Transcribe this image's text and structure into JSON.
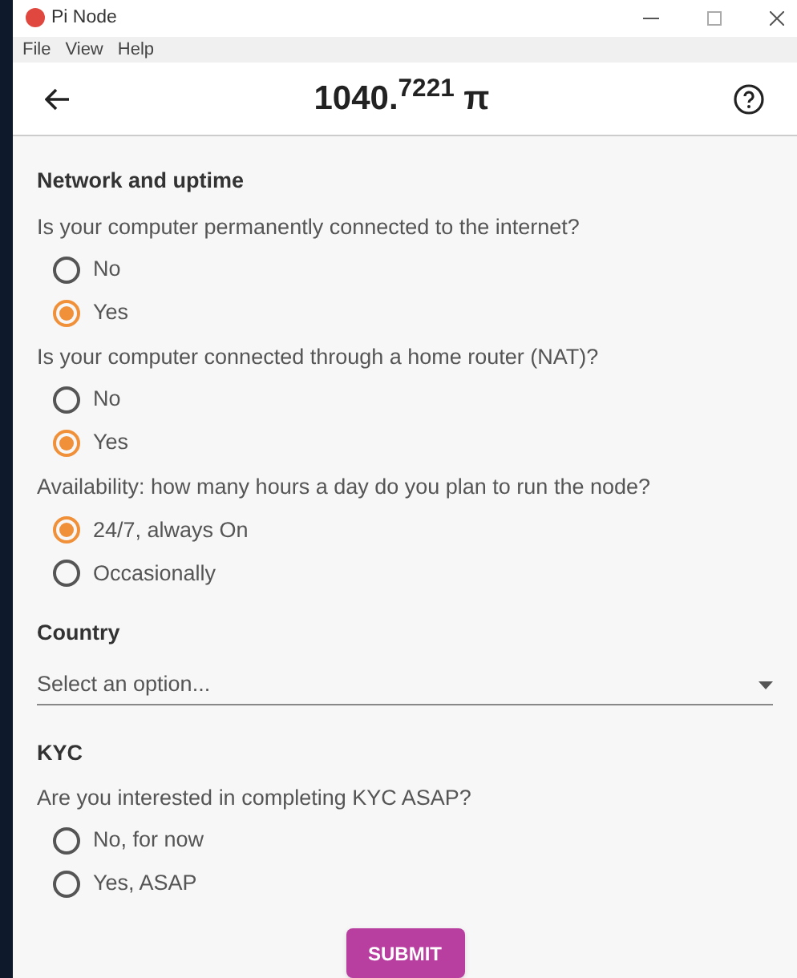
{
  "window": {
    "title": "Pi Node"
  },
  "menu": [
    "File",
    "View",
    "Help"
  ],
  "header": {
    "balance": "1040.$^{7221}$ π"
  },
  "sections": [
    {
      "title": "Network and uptime",
      "questions": [
        {
          "text": "Is your computer permanently connected to the internet?",
          "options": [
            {
              "label": "No",
              "selected": false
            },
            {
              "label": "Yes",
              "selected": true
            }
          ]
        },
        {
          "text": "Is your computer connected through a home router (NAT)?",
          "options": [
            {
              "label": "No",
              "selected": false
            },
            {
              "label": "Yes",
              "selected": true
            }
          ]
        },
        {
          "text": "Availability: how many hours a day do you plan to run the node?",
          "options": [
            {
              "label": "24/7, always On",
              "selected": true
            },
            {
              "label": "Occasionally",
              "selected": false
            }
          ]
        }
      ]
    },
    {
      "title": "Country",
      "select": {
        "placeholder": "Select an option..."
      }
    },
    {
      "title": "KYC",
      "questions": [
        {
          "text": "Are you interested in completing KYC ASAP?",
          "options": [
            {
              "label": "No, for now",
              "selected": false
            },
            {
              "label": "Yes, ASAP",
              "selected": false
            }
          ]
        }
      ]
    }
  ],
  "submit": "SUBMIT"
}
